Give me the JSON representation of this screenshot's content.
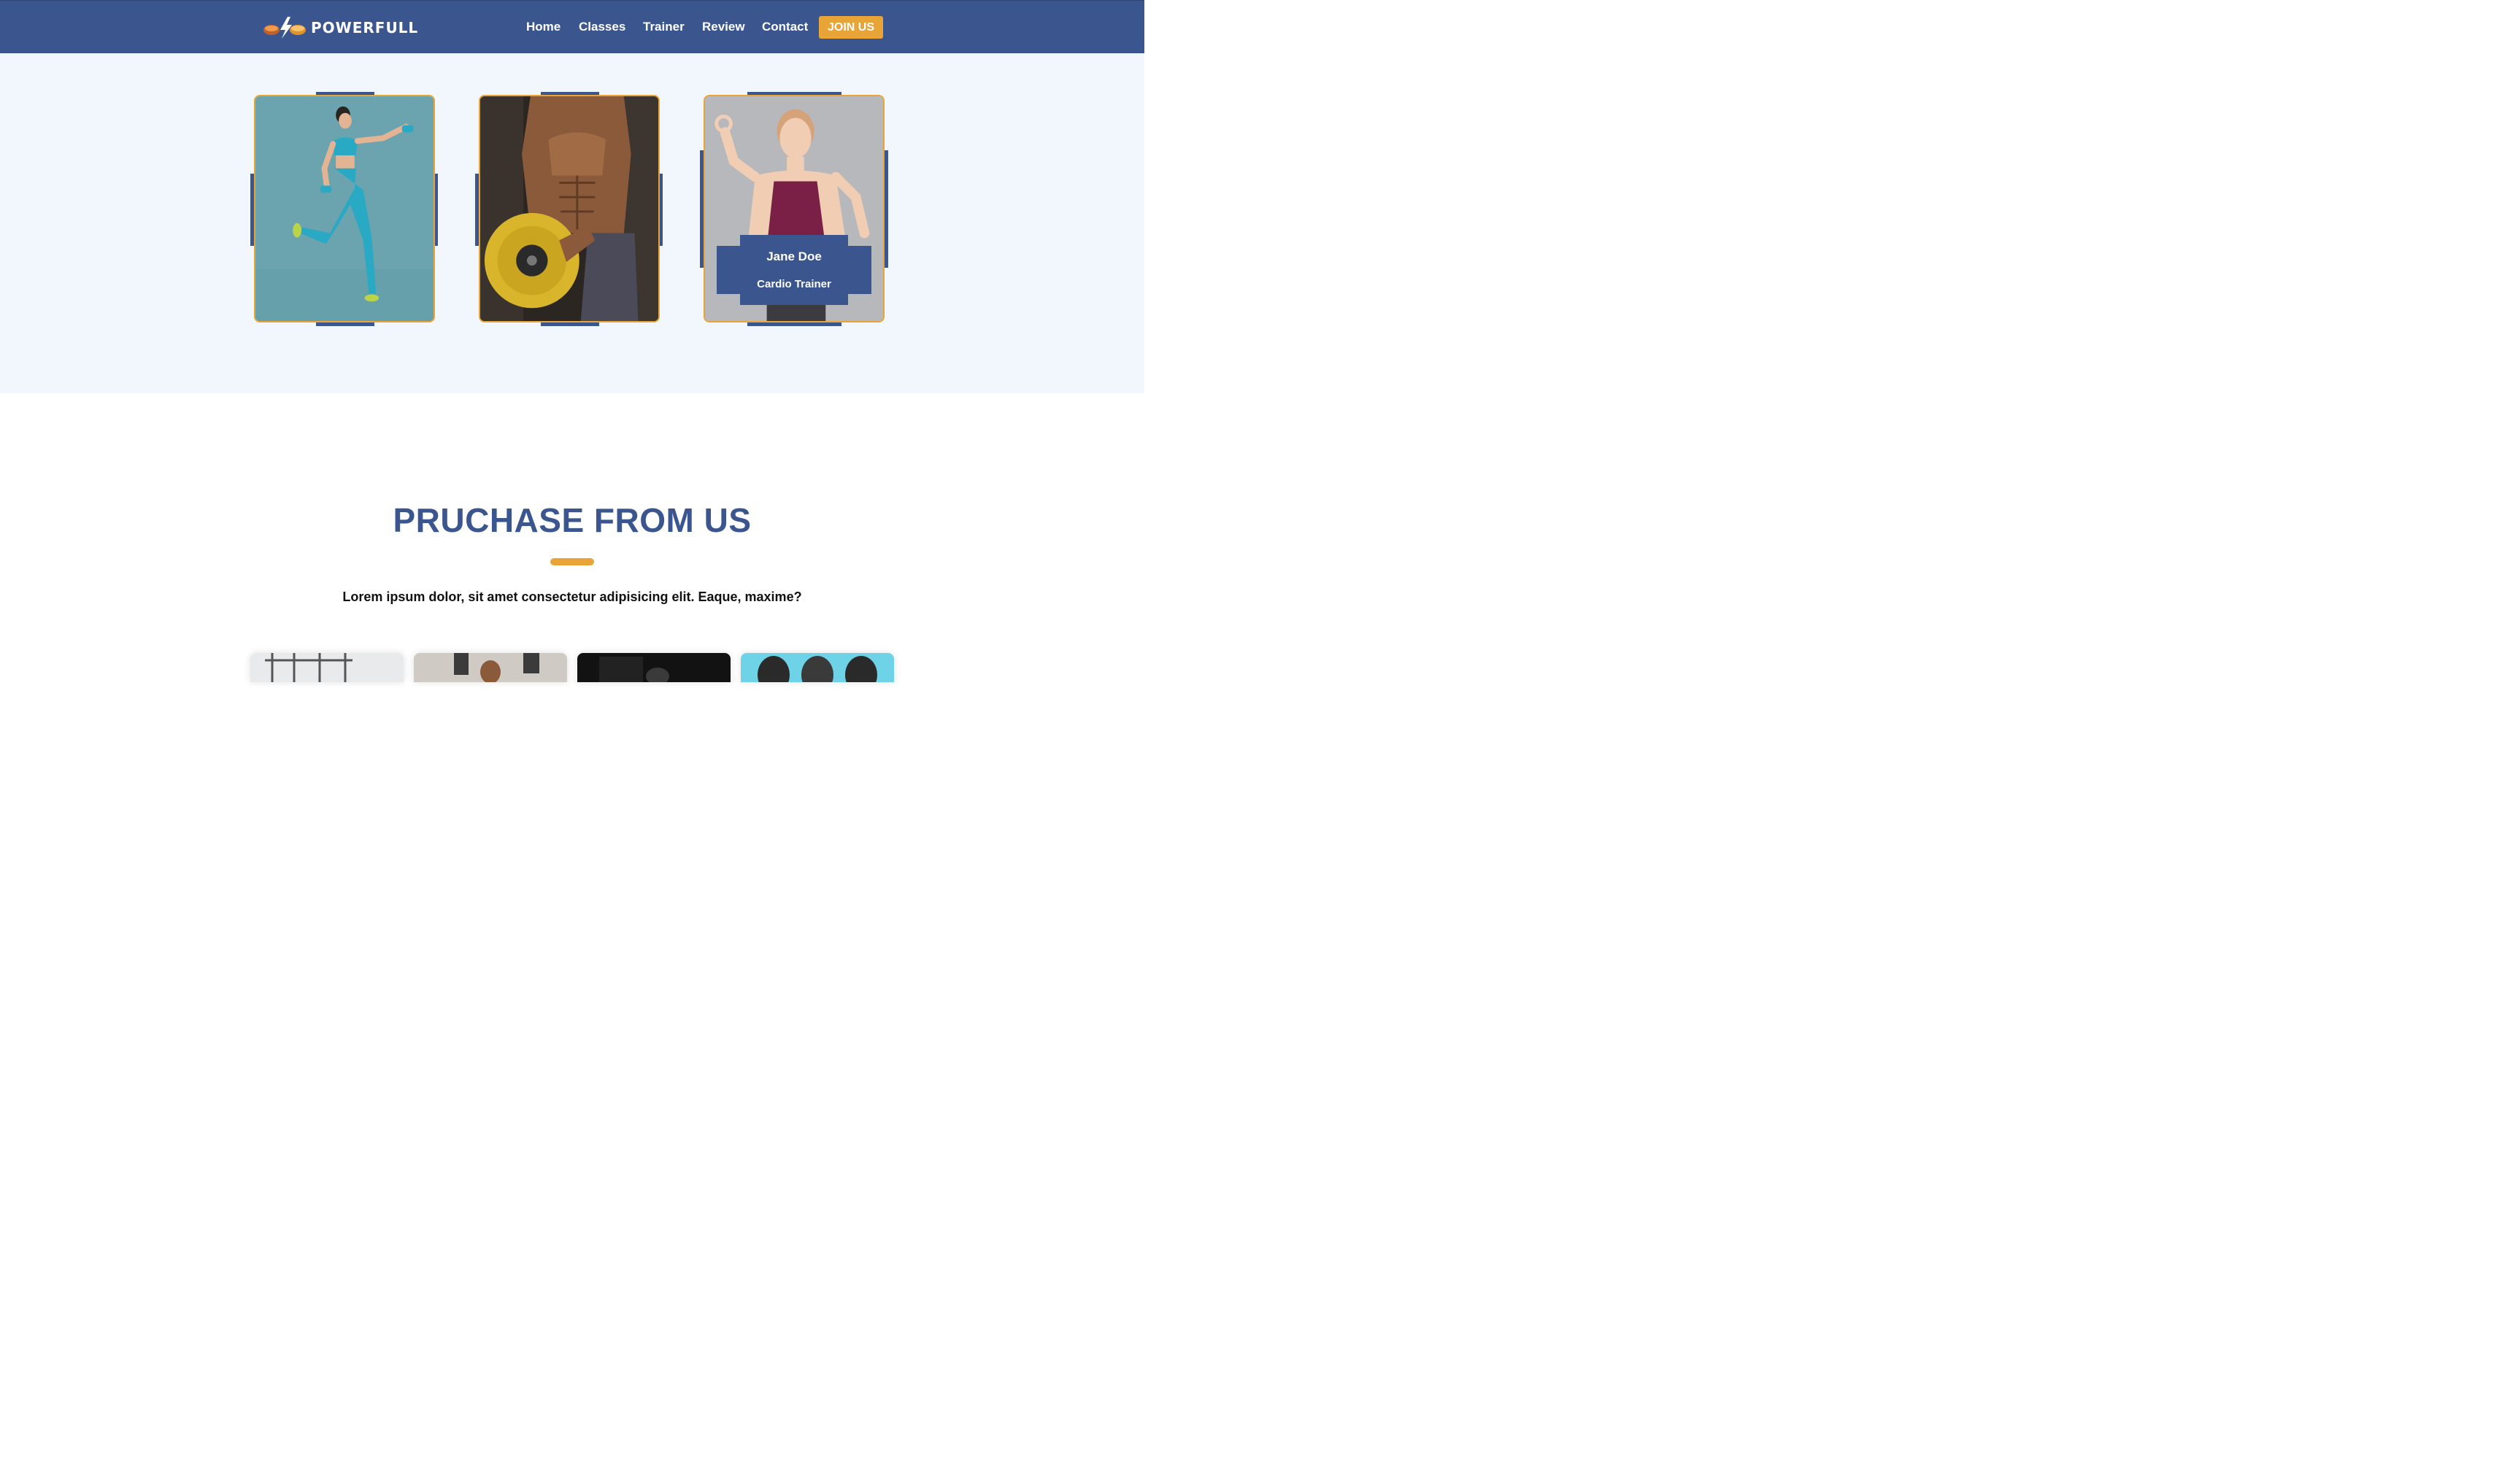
{
  "brand": {
    "name": "POWERFULL",
    "logo_icon": "dumbbell-bolt-icon"
  },
  "nav": {
    "links": [
      "Home",
      "Classes",
      "Trainer",
      "Review",
      "Contact"
    ],
    "cta": "JOIN US"
  },
  "trainers": {
    "cards": [
      {
        "image": "runner-woman-dumbbells-image"
      },
      {
        "image": "bodybuilder-weight-plate-image"
      },
      {
        "image": "woman-ok-sign-image",
        "name": "Jane Doe",
        "role": "Cardio Trainer"
      }
    ]
  },
  "purchase": {
    "title": "PRUCHASE FROM US",
    "description": "Lorem ipsum dolor, sit amet consectetur adipisicing elit. Eaque, maxime?",
    "products": [
      "gym-rack-image",
      "trainer-boxing-image",
      "dark-gym-image",
      "dumbbells-closeup-image"
    ]
  },
  "colors": {
    "primary": "#3b568f",
    "accent": "#e8a437",
    "section_bg": "#f2f7fe"
  }
}
